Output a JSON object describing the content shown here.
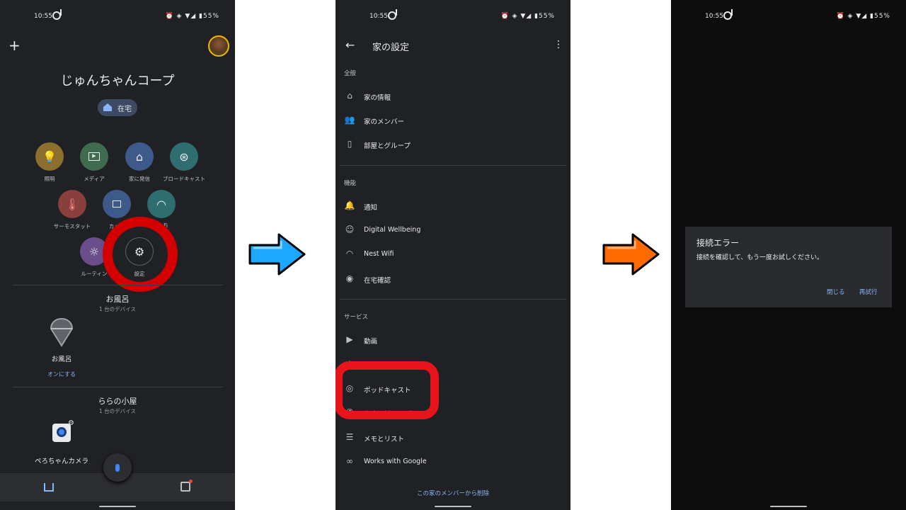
{
  "status_bar": {
    "time": "10:55",
    "battery": "55%"
  },
  "screen1": {
    "home_name": "じゅんちゃんコープ",
    "presence_chip": "在宅",
    "actions": [
      {
        "label": "照明",
        "icon": "lightbulb-icon",
        "color": "#8c6e2e"
      },
      {
        "label": "メディア",
        "icon": "media-icon",
        "color": "#3f6b4e"
      },
      {
        "label": "家に発信",
        "icon": "call-home-icon",
        "color": "#3d5a8a"
      },
      {
        "label": "ブロードキャスト",
        "icon": "broadcast-icon",
        "color": "#2f6e70"
      },
      {
        "label": "サーモスタット",
        "icon": "thermometer-icon",
        "color": "#8a3f3f"
      },
      {
        "label": "カメラ",
        "icon": "camera-icon",
        "color": "#3d5a8a"
      },
      {
        "label": "Wi-Fi",
        "icon": "wifi-icon",
        "color": "#2f6e70"
      },
      {
        "label": "ルーティン",
        "icon": "routine-icon",
        "color": "#6a4d8a"
      },
      {
        "label": "設定",
        "icon": "gear-icon",
        "color": "#202124"
      }
    ],
    "room1": {
      "name": "お風呂",
      "count": "1 台のデバイス",
      "device": "お風呂",
      "action": "オンにする"
    },
    "room2": {
      "name": "ららの小屋",
      "count": "1 台のデバイス",
      "device": "ぺろちゃんカメラ"
    }
  },
  "screen2": {
    "title": "家の設定",
    "sections": {
      "general": "全般",
      "features": "機能",
      "services": "サービス"
    },
    "general_items": [
      "家の情報",
      "家のメンバー",
      "部屋とグループ"
    ],
    "feature_items": [
      "通知",
      "Digital Wellbeing",
      "Nest Wifi",
      "在宅確認"
    ],
    "service_items": [
      "動画",
      "音楽",
      "ポッドキャスト",
      "音声通話とビデオ通話",
      "メモとリスト",
      "Works with Google"
    ],
    "leave_link": "この家のメンバーから削除"
  },
  "screen3": {
    "dialog_title": "接続エラー",
    "dialog_message": "接続を確認して、もう一度お試しください。",
    "close_label": "閉じる",
    "retry_label": "再試行"
  },
  "colors": {
    "accent": "#8ab4f8",
    "highlight_red": "#d40000",
    "arrow_blue": "#1ea7ff",
    "arrow_orange": "#ff6a00"
  }
}
